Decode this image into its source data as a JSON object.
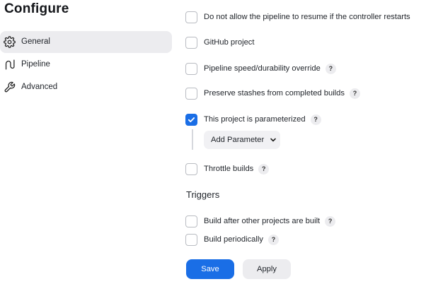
{
  "page": {
    "title": "Configure"
  },
  "sidebar": {
    "items": [
      {
        "label": "General",
        "icon": "gear-icon",
        "active": true
      },
      {
        "label": "Pipeline",
        "icon": "pipeline-icon",
        "active": false
      },
      {
        "label": "Advanced",
        "icon": "wrench-icon",
        "active": false
      }
    ]
  },
  "options": [
    {
      "label": "Do not allow the pipeline to resume if the controller restarts",
      "checked": false,
      "help": false
    },
    {
      "label": "GitHub project",
      "checked": false,
      "help": false
    },
    {
      "label": "Pipeline speed/durability override",
      "checked": false,
      "help": true
    },
    {
      "label": "Preserve stashes from completed builds",
      "checked": false,
      "help": true
    },
    {
      "label": "This project is parameterized",
      "checked": true,
      "help": true
    },
    {
      "label": "Throttle builds",
      "checked": false,
      "help": true
    }
  ],
  "parameters": {
    "add_label": "Add Parameter"
  },
  "help_glyph": "?",
  "triggers": {
    "title": "Triggers",
    "options": [
      {
        "label": "Build after other projects are built",
        "checked": false,
        "help": true
      },
      {
        "label": "Build periodically",
        "checked": false,
        "help": true
      }
    ]
  },
  "actions": {
    "save_label": "Save",
    "apply_label": "Apply"
  },
  "colors": {
    "accent": "#1a6ee6",
    "sidebar_active": "#ececef",
    "button_secondary": "#ececef"
  }
}
